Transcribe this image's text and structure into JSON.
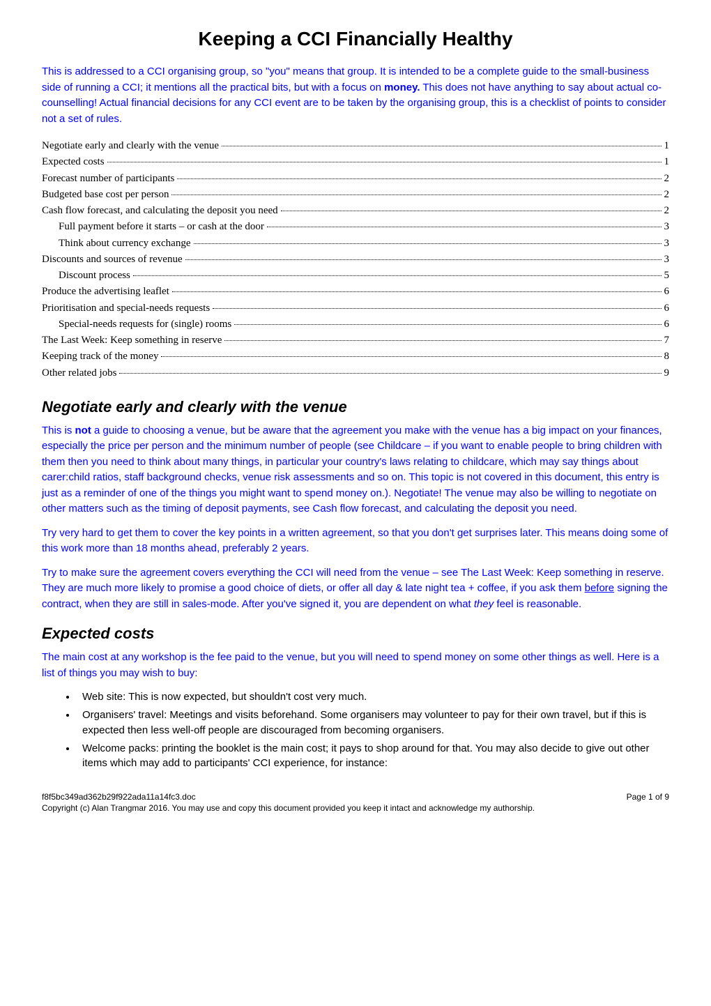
{
  "title": "Keeping a CCI Financially Healthy",
  "intro": "This is addressed to a CCI organising group, so \"you\" means that group.    It is intended to be a complete guide to the small-business side of running a CCI; it mentions all the practical bits, but with a focus on money.   This does not have anything to say about actual co-counselling!  Actual financial decisions for any CCI event are to be taken by the organising group, this is a checklist of points to consider not a set of rules.",
  "intro_bold_word": "money.",
  "toc": [
    {
      "label": "Negotiate early and clearly with the venue",
      "page": "1",
      "indent": 0
    },
    {
      "label": "Expected costs",
      "page": "1",
      "indent": 0
    },
    {
      "label": "Forecast number of participants",
      "page": "2",
      "indent": 0
    },
    {
      "label": "Budgeted base cost per person",
      "page": "2",
      "indent": 0
    },
    {
      "label": "Cash flow forecast, and calculating the deposit you need",
      "page": "2",
      "indent": 0
    },
    {
      "label": "Full payment before it starts – or cash at the door",
      "page": "3",
      "indent": 1
    },
    {
      "label": "Think about currency exchange",
      "page": "3",
      "indent": 1
    },
    {
      "label": "Discounts and sources of revenue",
      "page": "3",
      "indent": 0
    },
    {
      "label": "Discount process",
      "page": "5",
      "indent": 1
    },
    {
      "label": "Produce the advertising leaflet",
      "page": "6",
      "indent": 0
    },
    {
      "label": "Prioritisation and special-needs requests",
      "page": "6",
      "indent": 0
    },
    {
      "label": "Special-needs requests for (single) rooms",
      "page": "6",
      "indent": 1
    },
    {
      "label": "The Last Week:  Keep something in reserve",
      "page": "7",
      "indent": 0
    },
    {
      "label": "Keeping track of the money",
      "page": "8",
      "indent": 0
    },
    {
      "label": "Other related jobs",
      "page": "9",
      "indent": 0
    }
  ],
  "section1": {
    "heading": "Negotiate early and clearly with the venue",
    "p1": "This is not a guide to choosing a venue, but be aware that the agreement you make with the venue has a big impact on your finances, especially the price per person and the minimum number of people (see Childcare – if you want to enable people to bring children with them then you need to think about many things, in particular your country's laws relating to childcare, which may say things about carer:child ratios, staff background checks, venue risk assessments and so on.   This topic is not covered in this document, this entry is just as a reminder of one of the things you might want to spend money on.).  Negotiate!   The venue may also be willing to negotiate on other matters such as the timing of deposit payments, see Cash flow forecast, and calculating the deposit you need.",
    "p2": "Try very hard to get them to cover the key points in a written agreement, so that you don't get surprises later.   This means doing some of this work more than 18 months ahead, preferably 2 years.",
    "p3_part1": "Try to make sure the agreement covers everything the CCI will need from the venue – see The Last Week:   Keep something in reserve.   They are much more likely to promise a good choice of diets, or offer all day & late night tea + coffee, if you ask them ",
    "p3_underlined": "before",
    "p3_part2": " signing the contract, when they are still in sales-mode.    After you've signed it, you are dependent on what ",
    "p3_italic": "they",
    "p3_part3": " feel is reasonable."
  },
  "section2": {
    "heading": "Expected costs",
    "p1": "The main cost at any workshop is the fee paid to the venue, but you will need to spend money on some other things as well.    Here is a list of things you may wish to buy:",
    "bullets": [
      "Web site: This is now expected, but shouldn't cost very much.",
      "Organisers' travel: Meetings and visits beforehand.  Some organisers may volunteer to pay for their own travel, but if this is expected then less well-off people are discouraged from becoming organisers.",
      "Welcome packs: printing the booklet is the main cost; it pays to shop around for that.    You may also decide to give out other items which may add to participants' CCI experience, for instance:"
    ]
  },
  "footer": {
    "filename": "f8f5bc349ad362b29f922ada11a14fc3.doc",
    "page": "Page 1 of 9",
    "copyright": "Copyright (c) Alan Trangmar 2016.  You may use and copy this document provided you keep it intact and acknowledge my authorship."
  }
}
